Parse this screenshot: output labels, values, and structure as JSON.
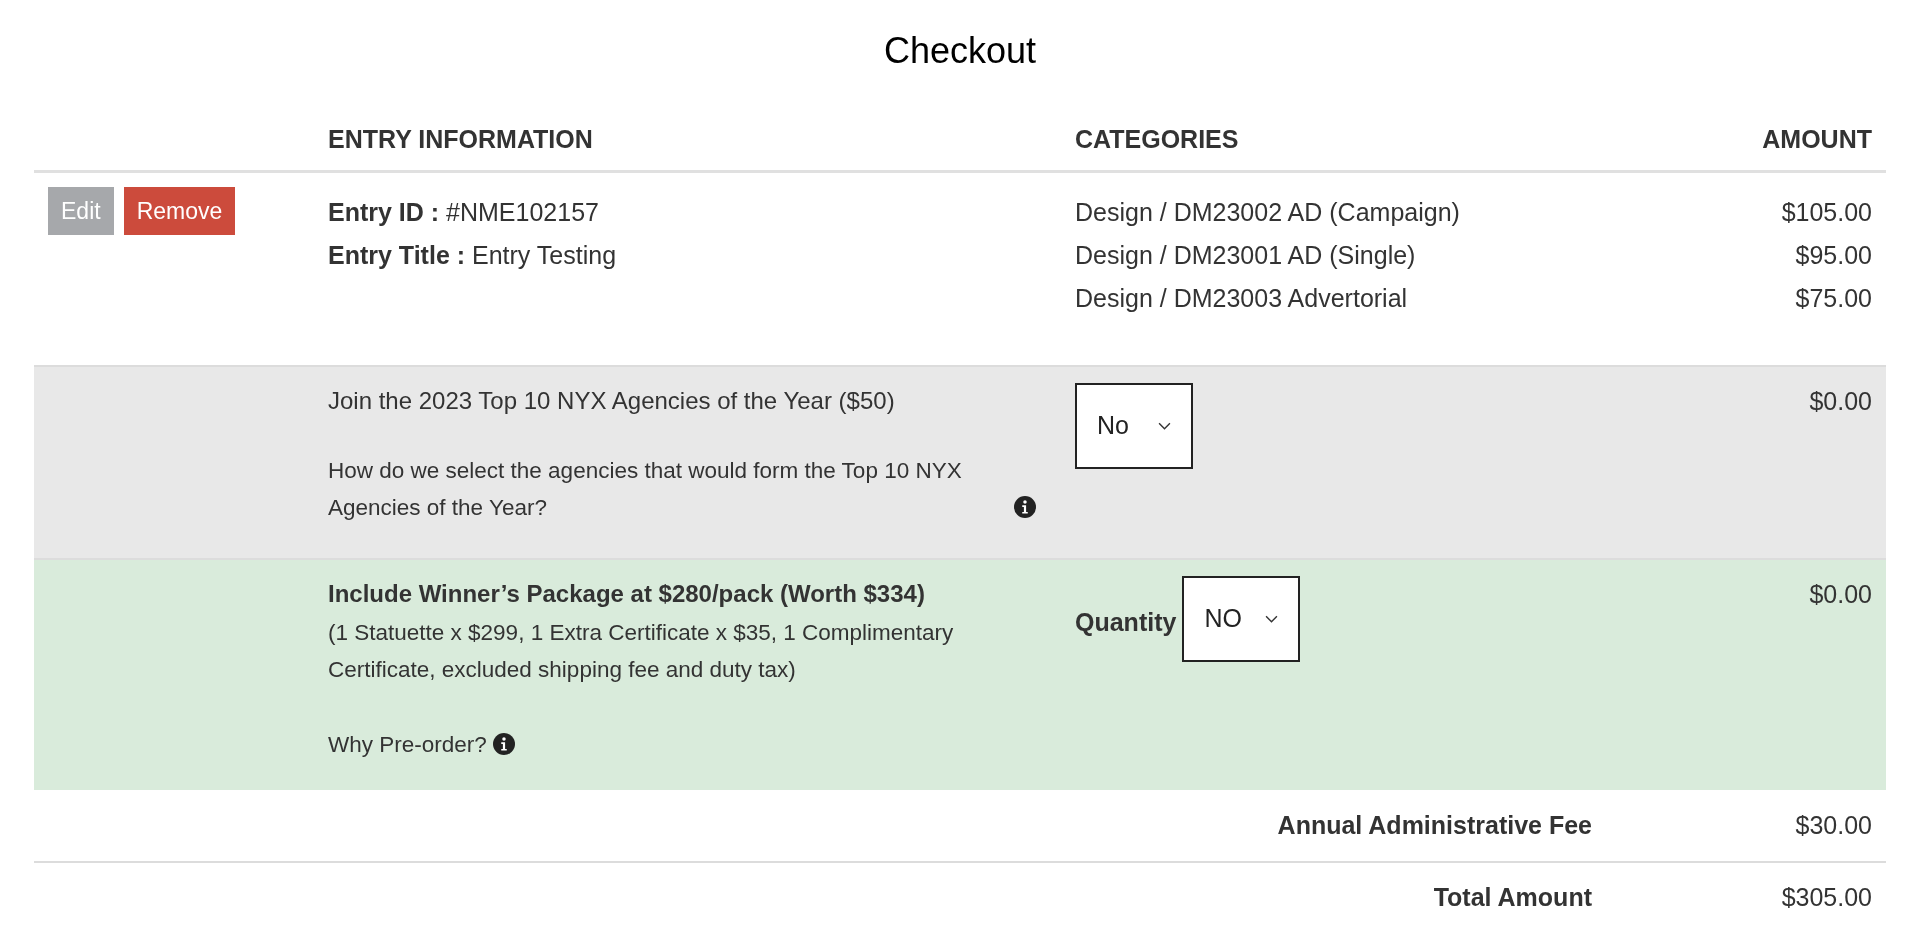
{
  "title": "Checkout",
  "columns": [
    "ENTRY INFORMATION",
    "CATEGORIES",
    "AMOUNT"
  ],
  "entry": {
    "buttons": [
      {
        "label": "Edit",
        "kind": "edit"
      },
      {
        "label": "Remove",
        "kind": "remove"
      }
    ],
    "fields": [
      {
        "label": "Entry ID :",
        "value": "#NME102157"
      },
      {
        "label": "Entry Title :",
        "value": "Entry Testing"
      }
    ],
    "categories": [
      {
        "name": "Design / DM23002 AD (Campaign)",
        "amount": "$105.00"
      },
      {
        "name": "Design / DM23001 AD (Single)",
        "amount": "$95.00"
      },
      {
        "name": "Design / DM23003 Advertorial",
        "amount": "$75.00"
      }
    ]
  },
  "addons": [
    {
      "kind": "agency",
      "title": "Join the 2023 Top 10 NYX Agencies of the Year ($50)",
      "details": "How do we select the agencies that would form the Top 10 NYX Agencies of the Year?",
      "select_value": "No",
      "amount": "$0.00"
    },
    {
      "kind": "package",
      "title": "Include Winner’s Package at $280/pack (Worth $334)",
      "subtitle": "(1 Statuette x $299, 1 Extra Certificate x $35, 1 Complimentary Certificate, excluded shipping fee and duty tax)",
      "details": "Why Pre-order?",
      "select_label": "Quantity",
      "select_value": "NO",
      "amount": "$0.00"
    }
  ],
  "summary": [
    {
      "label": "Annual Administrative Fee",
      "amount": "$30.00"
    },
    {
      "label": "Total Amount",
      "amount": "$305.00"
    }
  ]
}
